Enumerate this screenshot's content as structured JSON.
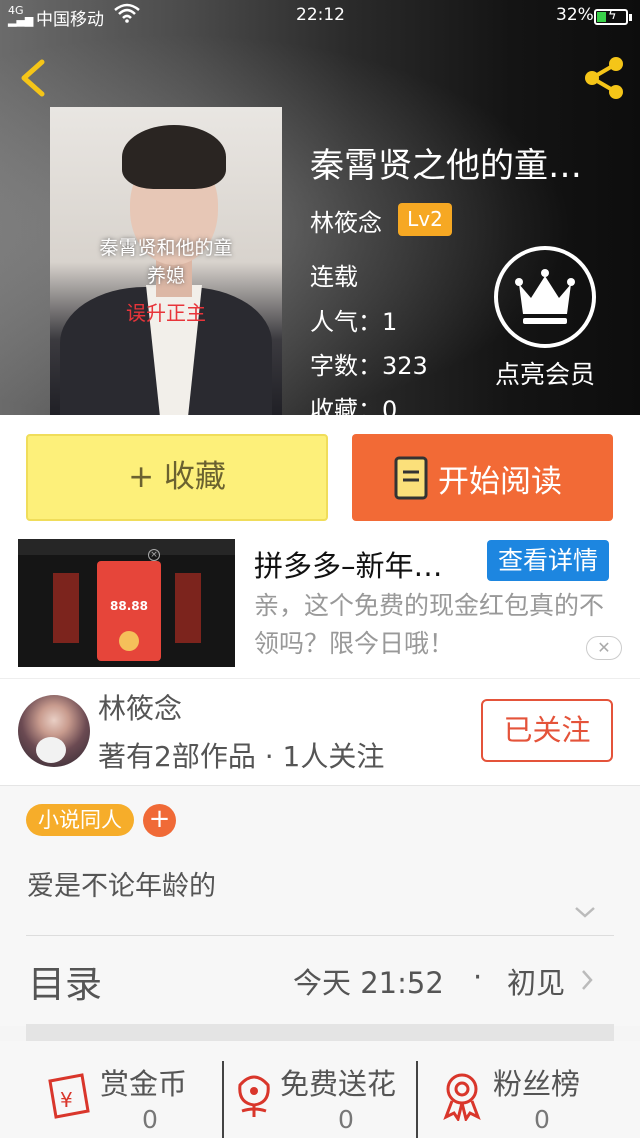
{
  "status_bar": {
    "signal": "4G",
    "carrier": "中国移动",
    "time": "22:12",
    "battery": "32%",
    "battery_level": 0.32
  },
  "book": {
    "title": "秦霄贤之他的童…",
    "cover_text_line1": "秦霄贤和他的童",
    "cover_text_line2": "养媳",
    "cover_text_line3": "误升正主",
    "author": "林筱念",
    "level": "Lv2",
    "status": "连载",
    "popularity_label": "人气：",
    "popularity": "1",
    "words_label": "字数：",
    "words": "323",
    "favorites_label": "收藏：",
    "favorites": "0"
  },
  "vip": {
    "label": "点亮会员"
  },
  "actions": {
    "collect": "+ 收藏",
    "read": "开始阅读"
  },
  "ad": {
    "title": "拼多多–新年…",
    "button": "查看详情",
    "description": "亲，这个免费的现金红包真的不领吗？限今日哦！",
    "image_amount": "88.88",
    "close": "✕"
  },
  "author_block": {
    "name": "林筱念",
    "meta": "著有2部作品 · 1人关注",
    "follow": "已关注"
  },
  "tags": {
    "items": [
      "小说同人"
    ],
    "add": "+"
  },
  "description": "爱是不论年龄的",
  "catalog": {
    "label": "目录",
    "updated": "今天 21:52",
    "separator": "·",
    "chapter": "初见"
  },
  "bottom": {
    "items": [
      {
        "label": "赏金币",
        "count": "0",
        "icon": "reward-coin-icon"
      },
      {
        "label": "免费送花",
        "count": "0",
        "icon": "flower-icon"
      },
      {
        "label": "粉丝榜",
        "count": "0",
        "icon": "medal-icon"
      }
    ]
  },
  "colors": {
    "accent_orange": "#f26a36",
    "collect_yellow": "#fdf07a",
    "level_badge": "#f6a823",
    "ad_blue": "#1d86e0",
    "follow_red": "#e4533a",
    "share_icon": "#f5c518"
  }
}
